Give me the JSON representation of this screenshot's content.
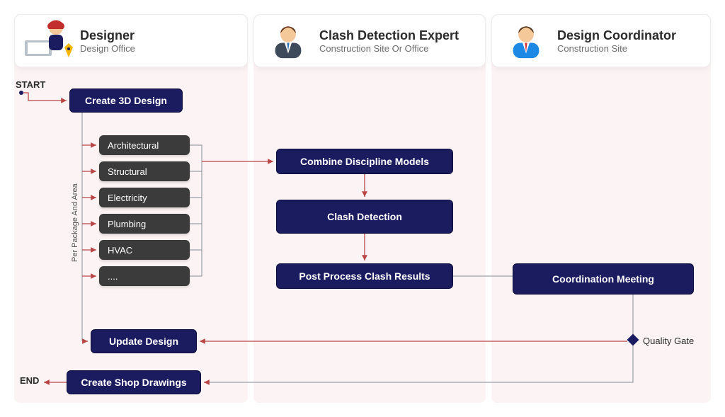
{
  "lanes": {
    "designer": {
      "title": "Designer",
      "sub": "Design Office"
    },
    "expert": {
      "title": "Clash Detection Expert",
      "sub": "Construction Site Or Office"
    },
    "coord": {
      "title": "Design Coordinator",
      "sub": "Construction Site"
    }
  },
  "labels": {
    "start": "START",
    "end": "END",
    "perPackage": "Per Package And Area",
    "qualityGate": "Quality Gate"
  },
  "designer_nodes": {
    "create3d": "Create 3D Design",
    "updateDesign": "Update Design",
    "shopDrawings": "Create Shop Drawings"
  },
  "disciplines": {
    "d0": "Architectural",
    "d1": "Structural",
    "d2": "Electricity",
    "d3": "Plumbing",
    "d4": "HVAC",
    "d5": "...."
  },
  "expert_nodes": {
    "combine": "Combine Discipline Models",
    "clash": "Clash Detection",
    "postprocess": "Post Process Clash Results"
  },
  "coord_nodes": {
    "meeting": "Coordination Meeting"
  },
  "colors": {
    "node": "#1B1B60",
    "sub": "#3B3B3B",
    "laneBg": "#FCF3F4",
    "arrow": "#b94646"
  }
}
